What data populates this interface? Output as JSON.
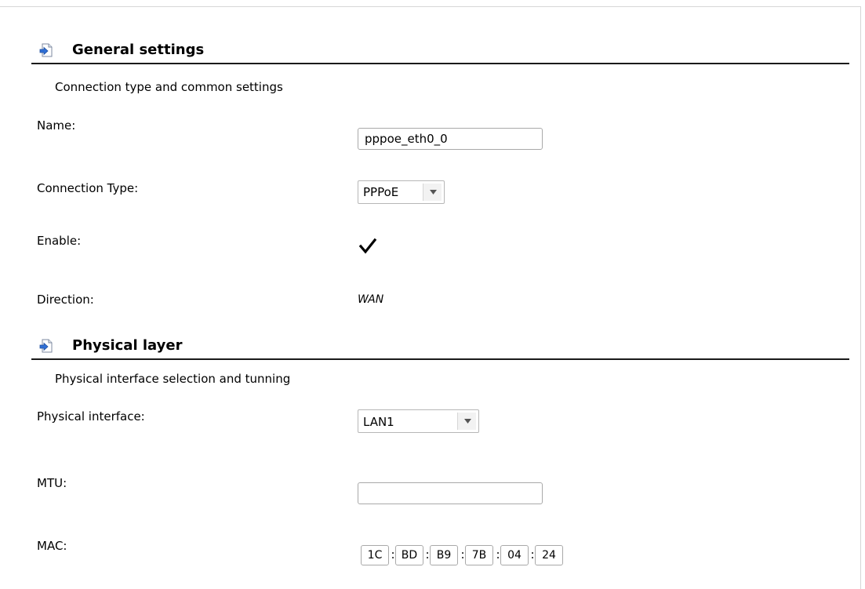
{
  "general": {
    "title": "General settings",
    "description": "Connection type and common settings",
    "name_label": "Name:",
    "name_value": "pppoe_eth0_0",
    "connection_type_label": "Connection Type:",
    "connection_type_value": "PPPoE",
    "enable_label": "Enable:",
    "enable_checked": true,
    "direction_label": "Direction:",
    "direction_value": "WAN"
  },
  "physical": {
    "title": "Physical layer",
    "description": "Physical interface selection and tunning",
    "interface_label": "Physical interface:",
    "interface_value": "LAN1",
    "mtu_label": "MTU:",
    "mtu_value": "",
    "mac_label": "MAC:",
    "mac_octets": [
      "1C",
      "BD",
      "B9",
      "7B",
      "04",
      "24"
    ],
    "mac_separator": ":"
  },
  "icons": {
    "section": "arrow-document-icon",
    "dropdown": "chevron-down-icon",
    "checkmark": "checkmark-icon"
  },
  "colors": {
    "header_rule": "#1a1a1a",
    "icon_blue": "#2f6fd6",
    "input_border": "#a9a9a9"
  }
}
